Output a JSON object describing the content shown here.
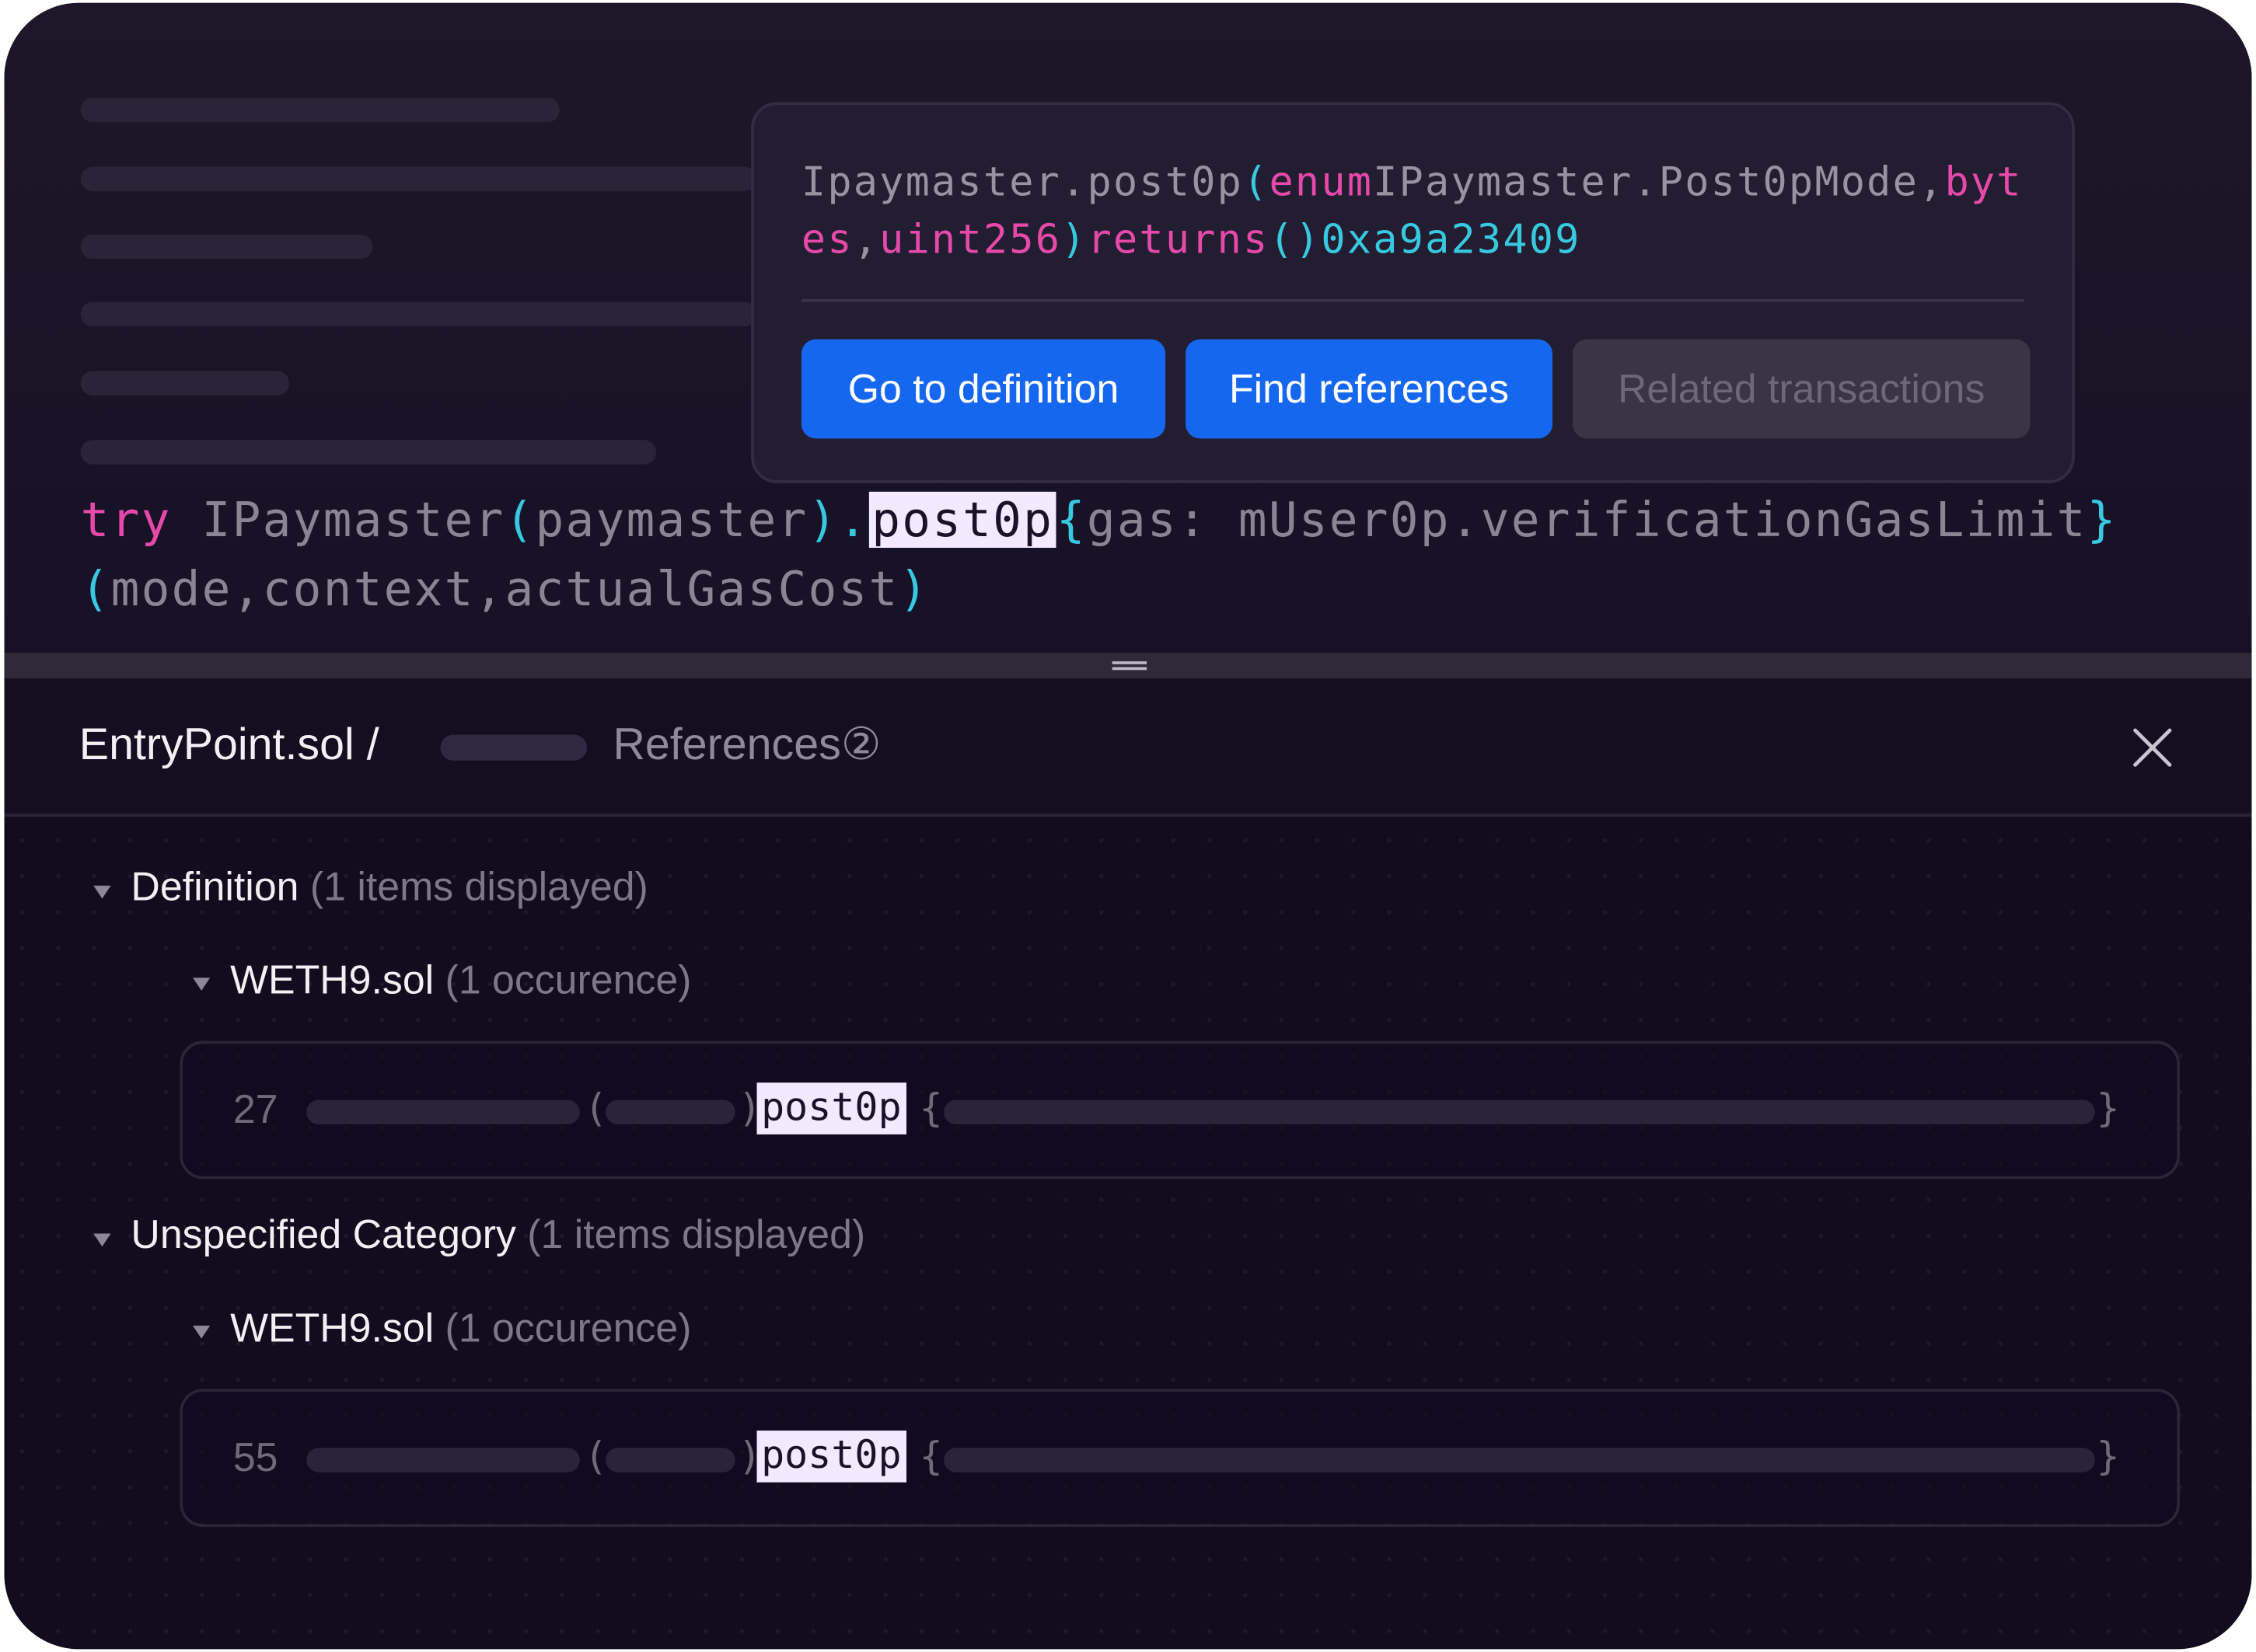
{
  "editor": {
    "code_line1": {
      "kw_try": "try",
      "iface": " IPaymaster",
      "paren_open": "(",
      "arg": "paymaster",
      "paren_close": ")",
      "dot": ".",
      "method": "post0p",
      "brace_open": "{",
      "gas_expr": "gas: mUser0p.verificationGasLimit",
      "brace_close": "}"
    },
    "code_line2": {
      "paren_open": "(",
      "args": "mode,context,actualGasCost",
      "paren_close": ")"
    }
  },
  "popover": {
    "signature": {
      "prefix": "Ipaymaster.post0p",
      "paren_open": "(",
      "enum_kw": "enum",
      "enum_type": "IPaymaster.Post0pMode,",
      "bytes_kw": "bytes",
      "comma1": ",",
      "uint_kw": "uint256",
      "paren_close": ")",
      "returns_kw": "returns",
      "ret_parens": "()",
      "selector": "0xa9a23409"
    },
    "buttons": {
      "go_to_definition": "Go to definition",
      "find_references": "Find references",
      "related_transactions": "Related transactions"
    }
  },
  "panel": {
    "breadcrumb_file": "EntryPoint.sol /",
    "references_label": "References②",
    "groups": [
      {
        "title": "Definition",
        "count": "(1 items displayed)",
        "file": "WETH9.sol",
        "occurrence": "(1 occurence)",
        "line_number": "27",
        "paren_open": "(",
        "paren_close": ")",
        "match": "post0p",
        "brace_open": "{",
        "brace_close": "}"
      },
      {
        "title": "Unspecified Category",
        "count": "(1 items displayed)",
        "file": "WETH9.sol",
        "occurrence": "(1 occurence)",
        "line_number": "55",
        "paren_open": "(",
        "paren_close": ")",
        "match": "post0p",
        "brace_open": "{",
        "brace_close": "}"
      }
    ]
  },
  "colors": {
    "background": "#140e22",
    "keyword": "#e64aa8",
    "punctuation": "#38c9e0",
    "primary_button": "#1667ef",
    "highlight": "#f3eaff"
  },
  "icons": [
    "close-icon",
    "caret-down-icon",
    "drag-handle-icon"
  ]
}
